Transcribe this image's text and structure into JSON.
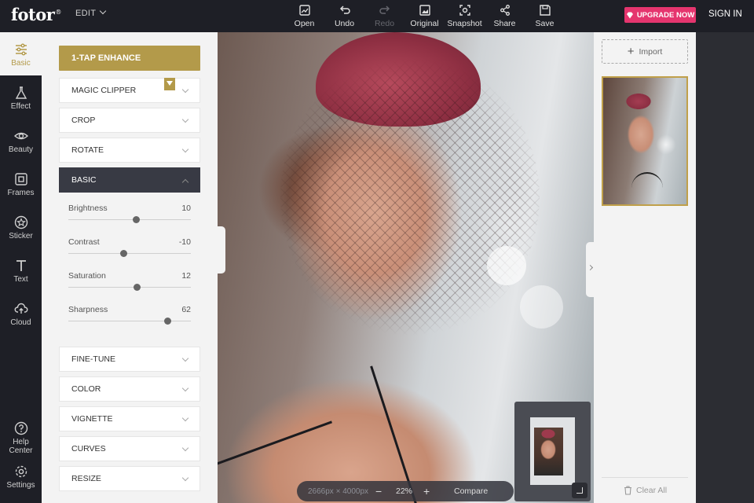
{
  "app": {
    "logo": "fotor",
    "logo_mark": "®",
    "edit_label": "EDIT"
  },
  "toolbar": [
    {
      "label": "Open",
      "icon": "open-icon",
      "enabled": true
    },
    {
      "label": "Undo",
      "icon": "undo-icon",
      "enabled": true
    },
    {
      "label": "Redo",
      "icon": "redo-icon",
      "enabled": false
    },
    {
      "label": "Original",
      "icon": "original-icon",
      "enabled": true
    },
    {
      "label": "Snapshot",
      "icon": "snapshot-icon",
      "enabled": true
    },
    {
      "label": "Share",
      "icon": "share-icon",
      "enabled": true
    },
    {
      "label": "Save",
      "icon": "save-icon",
      "enabled": true
    }
  ],
  "header": {
    "upgrade_label": "UPGRADE NOW",
    "signin_label": "SIGN IN"
  },
  "rail": [
    {
      "label": "Basic",
      "icon": "sliders-icon",
      "active": true
    },
    {
      "label": "Effect",
      "icon": "flask-icon"
    },
    {
      "label": "Beauty",
      "icon": "eye-icon"
    },
    {
      "label": "Frames",
      "icon": "frame-icon"
    },
    {
      "label": "Sticker",
      "icon": "star-icon"
    },
    {
      "label": "Text",
      "icon": "text-icon"
    },
    {
      "label": "Cloud",
      "icon": "cloud-upload-icon"
    },
    {
      "label": "Help Center",
      "icon": "help-icon"
    },
    {
      "label": "Settings",
      "icon": "gear-icon"
    }
  ],
  "panel": {
    "enhance_label": "1-TAP ENHANCE",
    "sections_top": [
      {
        "label": "MAGIC CLIPPER",
        "premium": true
      },
      {
        "label": "CROP"
      },
      {
        "label": "ROTATE"
      }
    ],
    "open_section": "BASIC",
    "sliders": [
      {
        "label": "Brightness",
        "value": "10",
        "position": 0.55
      },
      {
        "label": "Contrast",
        "value": "-10",
        "position": 0.45
      },
      {
        "label": "Saturation",
        "value": "12",
        "position": 0.56
      },
      {
        "label": "Sharpness",
        "value": "62",
        "position": 0.81
      }
    ],
    "sections_bottom": [
      {
        "label": "FINE-TUNE"
      },
      {
        "label": "COLOR"
      },
      {
        "label": "VIGNETTE"
      },
      {
        "label": "CURVES"
      },
      {
        "label": "RESIZE"
      }
    ]
  },
  "zoom": {
    "dimensions": "2666px × 4000px",
    "minus": "−",
    "level": "22%",
    "plus": "+",
    "compare_label": "Compare"
  },
  "right": {
    "import_label": "Import",
    "import_plus": "+",
    "clear_label": "Clear All"
  },
  "colors": {
    "accent_gold": "#b39a4a",
    "upgrade_pink": "#e5356e",
    "dark_bg": "#1e1f26"
  }
}
